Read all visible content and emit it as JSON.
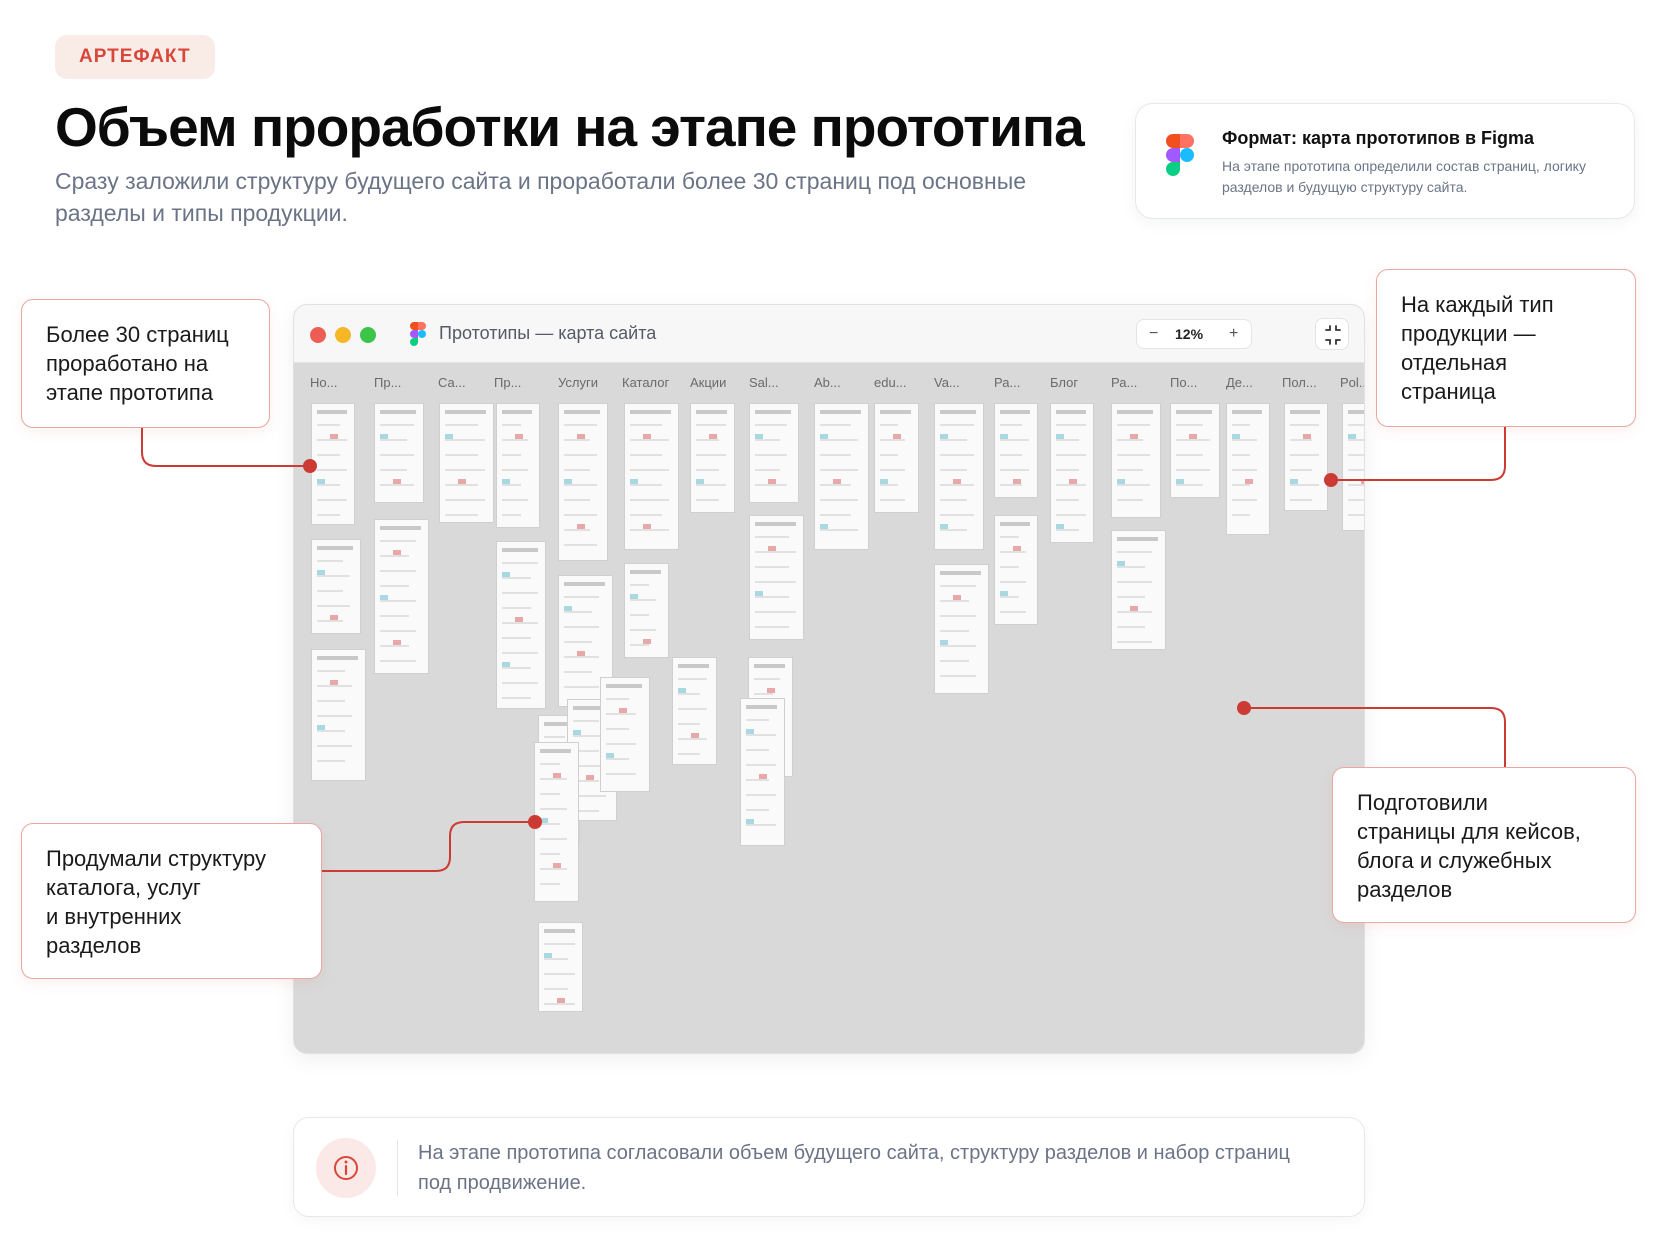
{
  "badge": "АРТЕФАКТ",
  "title": "Объем проработки на этапе прототипа",
  "subtitle": "Сразу заложили структуру будущего сайта и проработали более 30 страниц под основные разделы и типы продукции.",
  "format_card": {
    "title": "Формат: карта прототипов в Figma",
    "text": "На этапе прототипа определили состав страниц, логику разделов и будущую структуру сайта.",
    "icon": "figma-icon"
  },
  "callouts": {
    "pages_count": [
      "Более 30 страниц",
      "проработано на",
      "этапе прототипа"
    ],
    "per_product": [
      "На каждый тип",
      "продукции —",
      "отдельная",
      "страница"
    ],
    "catalog": [
      "Продумали структуру",
      "каталога, услуг",
      "и внутренних",
      "разделов"
    ],
    "cases": [
      "Подготовили",
      "страницы для кейсов,",
      "блога и служебных",
      "разделов"
    ]
  },
  "window": {
    "title": "Прототипы — карта сайта",
    "zoom": "12%",
    "zoom_minus": "−",
    "zoom_plus": "+",
    "columns": [
      "Но...",
      "Пр...",
      "Са...",
      "Пр...",
      "Услуги",
      "Каталог",
      "Акции",
      "Sal...",
      "Ab...",
      "edu...",
      "Va...",
      "Ра...",
      "Блог",
      "Ра...",
      "По...",
      "Де...",
      "Пол...",
      "Pol..."
    ]
  },
  "info": {
    "text": "На этапе прототипа согласовали объем будущего сайта, структуру разделов и набор страниц под продвижение.",
    "icon": "info-icon"
  },
  "colors": {
    "accent": "#d9473b",
    "badge_bg": "#f9ece7",
    "canvas": "#d9d9d9",
    "callout_border": "#e8a7a0"
  }
}
